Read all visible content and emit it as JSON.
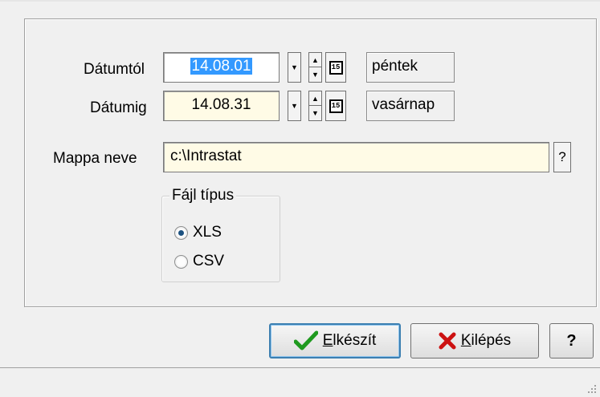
{
  "form": {
    "date_from_label": "Dátumtól",
    "date_from_value": "14.08.01",
    "date_from_day": "péntek",
    "date_to_label": "Dátumig",
    "date_to_value": "14.08.31",
    "date_to_day": "vasárnap",
    "calendar_icon_text": "15",
    "folder_label": "Mappa neve",
    "folder_value": "c:\\Intrastat",
    "folder_help": "?"
  },
  "file_type": {
    "legend": "Fájl típus",
    "options": [
      {
        "label": "XLS",
        "selected": true
      },
      {
        "label": "CSV",
        "selected": false
      }
    ]
  },
  "buttons": {
    "create_prefix": "",
    "create_mnemonic": "E",
    "create_rest": "lkészít",
    "exit_mnemonic": "K",
    "exit_rest": "ilépés",
    "help": "?"
  },
  "colors": {
    "accent_check": "#1f9a1f",
    "accent_x": "#cc1111",
    "selection": "#3399ff"
  }
}
